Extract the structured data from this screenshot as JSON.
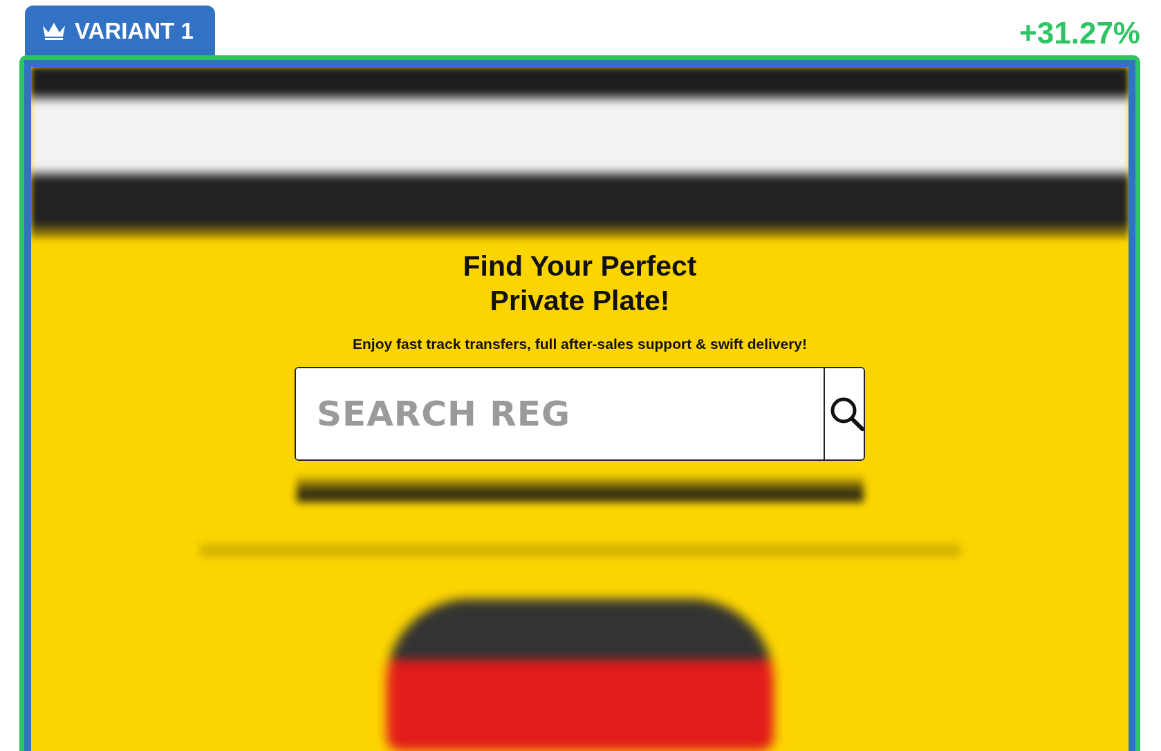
{
  "variant_tab": {
    "label": "VARIANT 1"
  },
  "uplift": "+31.27%",
  "hero": {
    "title_lines": [
      "Find Your Perfect",
      "Private Plate!"
    ],
    "subtitle": "Enjoy fast track transfers, full after-sales support & swift delivery!",
    "search": {
      "placeholder": "SEARCH REG"
    }
  }
}
